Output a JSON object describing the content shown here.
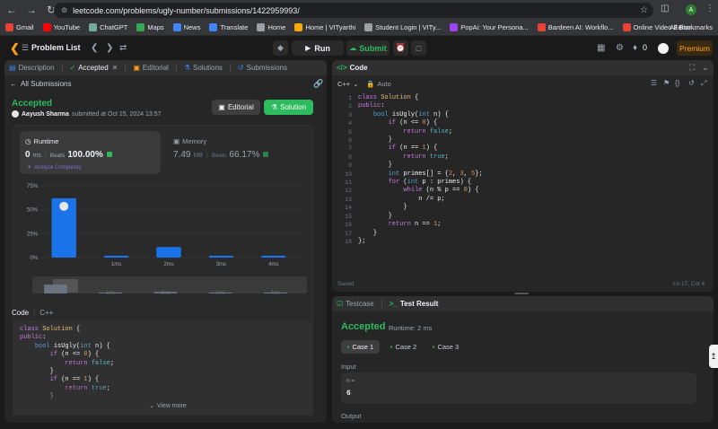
{
  "browser": {
    "url": "leetcode.com/problems/ugly-number/submissions/1422959993/",
    "avatar_letter": "A",
    "bookmarks": [
      {
        "label": "Gmail",
        "color": "#ea4335"
      },
      {
        "label": "YouTube",
        "color": "#ff0000"
      },
      {
        "label": "ChatGPT",
        "color": "#74aa9c"
      },
      {
        "label": "Maps",
        "color": "#34a853"
      },
      {
        "label": "News",
        "color": "#4285f4"
      },
      {
        "label": "Translate",
        "color": "#4285f4"
      },
      {
        "label": "Home",
        "color": "#9aa0a6"
      },
      {
        "label": "Home | VITyarthi",
        "color": "#f9ab00"
      },
      {
        "label": "Student Login | VITy...",
        "color": "#9aa0a6"
      },
      {
        "label": "PopAi: Your Persona...",
        "color": "#a142f4"
      },
      {
        "label": "Bardeen AI: Workflo...",
        "color": "#ea4335"
      },
      {
        "label": "Online Video Editor...",
        "color": "#ea4335"
      }
    ],
    "all_bookmarks": "All Bookmarks"
  },
  "header": {
    "problem_list": "Problem List",
    "run": "Run",
    "submit": "Submit",
    "fire_count": "0",
    "premium": "Premium"
  },
  "left_tabs": {
    "description": "Description",
    "accepted": "Accepted",
    "editorial": "Editorial",
    "solutions": "Solutions",
    "submissions": "Submissions"
  },
  "submission": {
    "all_submissions": "All Submissions",
    "status": "Accepted",
    "user": "Aayush Sharma",
    "submitted_at": "submitted at Oct 15, 2024 13:57",
    "editorial_btn": "Editorial",
    "solution_btn": "Solution",
    "runtime_label": "Runtime",
    "runtime_value": "0",
    "runtime_unit": "ms",
    "beats_label": "Beats",
    "runtime_beats": "100.00%",
    "analyze": "Analyze Complexity",
    "memory_label": "Memory",
    "memory_value": "7.49",
    "memory_unit": "MB",
    "memory_beats": "66.17%"
  },
  "chart_data": {
    "type": "bar",
    "categories": [
      "0ms",
      "1ms",
      "2ms",
      "3ms",
      "4ms"
    ],
    "x_tick_labels": [
      "",
      "1ms",
      "2ms",
      "3ms",
      "4ms"
    ],
    "values": [
      62,
      2,
      11,
      2,
      2
    ],
    "yticks": [
      "75%",
      "50%",
      "25%",
      "0%"
    ],
    "ylim": [
      0,
      75
    ],
    "bar_color": "#1a73e8"
  },
  "code_section": {
    "label": "Code",
    "lang": "C++",
    "view_more": "View more"
  },
  "editor": {
    "title": "Code",
    "lang": "C++",
    "auto": "Auto",
    "saved": "Saved",
    "cursor": "Ln 17, Col 4",
    "lines": [
      "class Solution {",
      "public:",
      "    bool isUgly(int n) {",
      "        if (n <= 0) {",
      "            return false;",
      "        }",
      "        if (n == 1) {",
      "            return true;",
      "        }",
      "        int primes[] = {2, 3, 5};",
      "        for (int p : primes) {",
      "            while (n % p == 0) {",
      "                n /= p;",
      "            }",
      "        }",
      "        return n == 1;",
      "    }",
      "};"
    ]
  },
  "test": {
    "testcase_tab": "Testcase",
    "result_tab": "Test Result",
    "status": "Accepted",
    "runtime": "Runtime: 2 ms",
    "cases": [
      "Case 1",
      "Case 2",
      "Case 3"
    ],
    "input_label": "Input",
    "var_name": "n =",
    "var_value": "6",
    "output_label": "Output"
  }
}
